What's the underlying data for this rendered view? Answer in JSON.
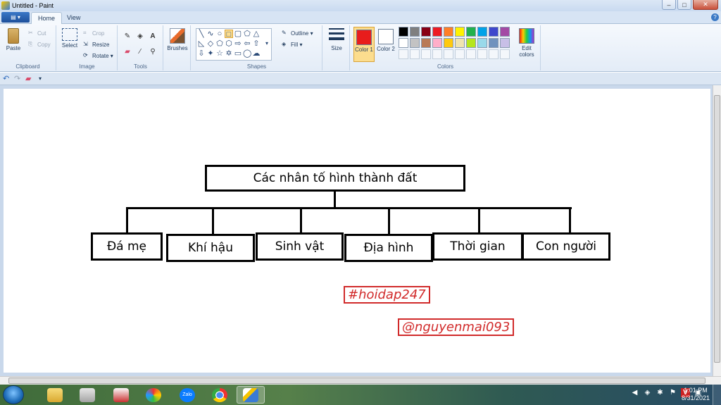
{
  "window": {
    "title": "Untitled - Paint",
    "min": "–",
    "max": "□",
    "close": "✕"
  },
  "tabs": {
    "app_menu": "▤ ▾",
    "home": "Home",
    "view": "View",
    "help": "?"
  },
  "clipboard": {
    "paste": "Paste",
    "cut": "Cut",
    "copy": "Copy",
    "label": "Clipboard"
  },
  "image": {
    "select": "Select",
    "crop": "Crop",
    "resize": "Resize",
    "rotate": "Rotate ▾",
    "label": "Image"
  },
  "tools": {
    "label": "Tools"
  },
  "brushes": {
    "label": "Brushes"
  },
  "shapes": {
    "outline": "Outline ▾",
    "fill": "Fill ▾",
    "label": "Shapes"
  },
  "size": {
    "label": "Size"
  },
  "colors": {
    "color1": "Color 1",
    "color2": "Color 2",
    "edit": "Edit colors",
    "label": "Colors",
    "color1_value": "#e81c1c",
    "color2_value": "#ffffff",
    "palette": [
      "#000000",
      "#7f7f7f",
      "#880015",
      "#ed1c24",
      "#ff7f27",
      "#fff200",
      "#22b14c",
      "#00a2e8",
      "#3f48cc",
      "#a349a4",
      "#ffffff",
      "#c3c3c3",
      "#b97a57",
      "#ffaec9",
      "#ffc90e",
      "#efe4b0",
      "#b5e61d",
      "#99d9ea",
      "#7092be",
      "#c8bfe7"
    ]
  },
  "diagram": {
    "root": "Các nhân tố hình thành đất",
    "children": [
      "Đá mẹ",
      "Khí hậu",
      "Sinh vật",
      "Địa hình",
      "Thời gian",
      "Con người"
    ],
    "hashtag": "#hoidap247",
    "author": "@nguyenmai093"
  },
  "taskbar": {
    "time": "1:01 PM",
    "date": "8/31/2021",
    "zalo": "Zalo"
  }
}
